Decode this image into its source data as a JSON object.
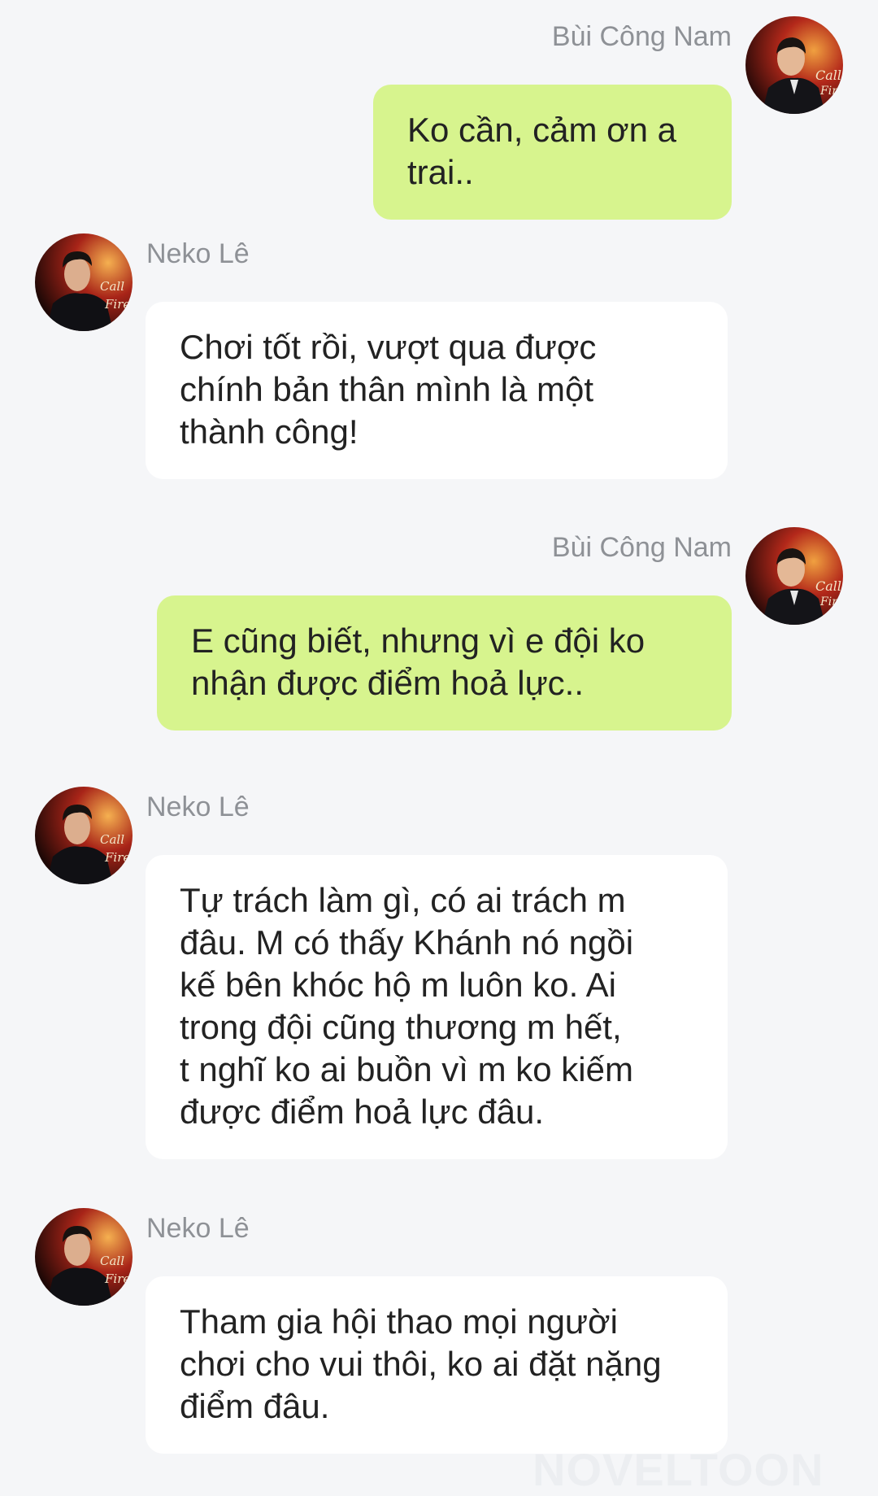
{
  "messages": [
    {
      "side": "right",
      "sender": "Bùi Công Nam",
      "text": "Ko cần, cảm ơn a trai.."
    },
    {
      "side": "left",
      "sender": "Neko Lê",
      "text": "Chơi tốt rồi, vượt qua được\nchính bản thân mình là một\nthành công!"
    },
    {
      "side": "right",
      "sender": "Bùi Công Nam",
      "text": "E cũng biết, nhưng vì e đội ko\nnhận được điểm hoả lực.."
    },
    {
      "side": "left",
      "sender": "Neko Lê",
      "text": "Tự trách làm gì, có ai trách m\nđâu. M có thấy Khánh nó ngồi\nkế bên khóc hộ m luôn ko. Ai\ntrong đội cũng thương m hết,\nt nghĩ ko ai buồn vì m ko kiếm\nđược điểm hoả lực đâu."
    },
    {
      "side": "left",
      "sender": "Neko Lê",
      "text": "Tham gia hội thao mọi người\nchơi cho vui thôi, ko ai đặt nặng\nđiểm đâu."
    }
  ],
  "watermark": "NOVELTOON",
  "colors": {
    "background": "#f5f6f8",
    "own_bubble": "#d7f48e",
    "other_bubble": "#ffffff",
    "sender_name": "#8e9196",
    "message_text": "#222222"
  },
  "icons": {
    "sender_avatar": "avatar-photo-icon"
  }
}
